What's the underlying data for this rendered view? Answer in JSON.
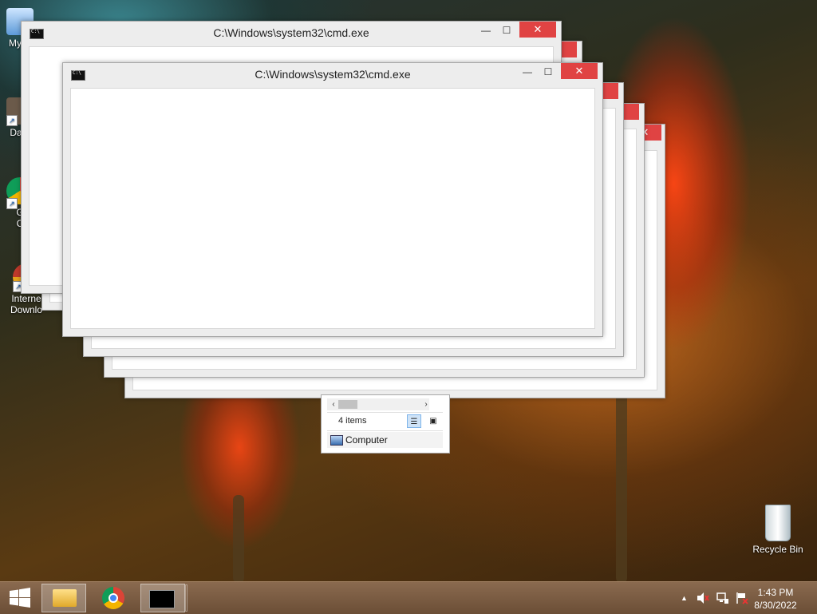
{
  "desktop": {
    "icons": [
      {
        "label": "My C",
        "icon": "computer-icon"
      },
      {
        "label": "Data",
        "icon": "data-shortcut-icon"
      },
      {
        "label": "G",
        "label2": "C",
        "icon": "chrome-icon"
      },
      {
        "label": "Interne",
        "label2": "Downlo",
        "icon": "internet-download-manager-icon"
      }
    ],
    "recycle_bin": {
      "label": "Recycle Bin",
      "icon": "recycle-bin-icon"
    }
  },
  "windows": [
    {
      "title": "C:\\Windows\\system32\\cmd.exe",
      "minimize": "—",
      "maximize": "☐",
      "close": "✕"
    },
    {
      "title": "C:\\Windows\\system32\\cmd.exe",
      "minimize": "—",
      "maximize": "☐",
      "close": "✕"
    }
  ],
  "explorer": {
    "status": "4 items",
    "address": "Computer",
    "scroll_left": "‹",
    "scroll_right": "›"
  },
  "taskbar": {
    "start_icon": "windows-start-icon",
    "pinned": [
      "file-explorer-icon",
      "chrome-icon",
      "cmd-icon"
    ],
    "tray": {
      "show_hidden": "▲",
      "volume_muted": "🔇",
      "network": "network-icon",
      "action_center": "flag-icon"
    },
    "clock": {
      "time": "1:43 PM",
      "date": "8/30/2022"
    }
  },
  "colors": {
    "close_button": "#e04343",
    "window_frame": "#ededed",
    "taskbar": "#7a5c42"
  }
}
